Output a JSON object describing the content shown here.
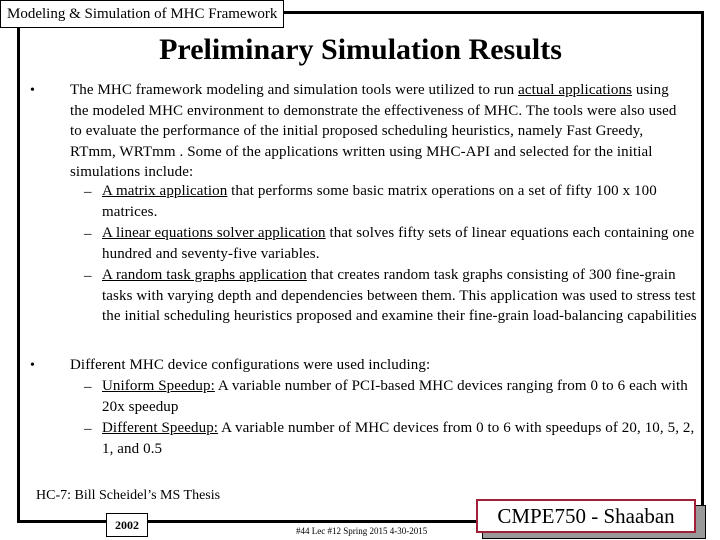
{
  "header": {
    "section_label": "Modeling & Simulation of MHC Framework",
    "title": "Preliminary Simulation Results"
  },
  "bullets": [
    {
      "marker": "•",
      "text_parts": [
        {
          "text": "The MHC framework modeling and simulation tools were utilized  to run ",
          "underline": false
        },
        {
          "text": "actual applications",
          "underline": true
        },
        {
          "text": " using the modeled MHC environment to demonstrate  the effectiveness of MHC.  The tools were also used to  evaluate the performance of the initial proposed scheduling heuristics, namely Fast Greedy, RTmm, WRTmm .   Some of the applications written using MHC-API and selected for the initial simulations include:",
          "underline": false
        }
      ],
      "sub_items": [
        {
          "marker": "–",
          "label": "A matrix application",
          "text": " that performs some basic matrix operations on a set of fifty 100 x 100 matrices."
        },
        {
          "marker": "–",
          "label": "A linear equations solver application",
          "text": " that solves fifty sets of linear equations each containing one hundred and seventy-five variables."
        },
        {
          "marker": "–",
          "label": "A random task graphs application",
          "text": " that creates random task graphs consisting of 300 fine-grain tasks with varying depth and dependencies between them.  This application was used to stress test the initial scheduling heuristics proposed and examine their fine-grain load-balancing capabilities"
        }
      ]
    },
    {
      "marker": "•",
      "text": "Different MHC device configurations were used including:",
      "sub_items": [
        {
          "marker": "–",
          "label": "Uniform Speedup:",
          "text": "  A variable number of PCI-based MHC devices ranging from 0 to 6 each with 20x speedup"
        },
        {
          "marker": "–",
          "label": "Different Speedup:",
          "text": "  A variable number of MHC devices from 0 to 6 with speedups of 20, 10, 5, 2, 1,  and 0.5"
        }
      ]
    }
  ],
  "footer": {
    "thesis_ref": "HC-7: Bill Scheidel’s MS Thesis",
    "year": "2002",
    "meta": "#44  Lec #12  Spring 2015  4-30-2015",
    "course_badge": "CMPE750 - Shaaban",
    "badge_border_color": "#a0203a"
  }
}
